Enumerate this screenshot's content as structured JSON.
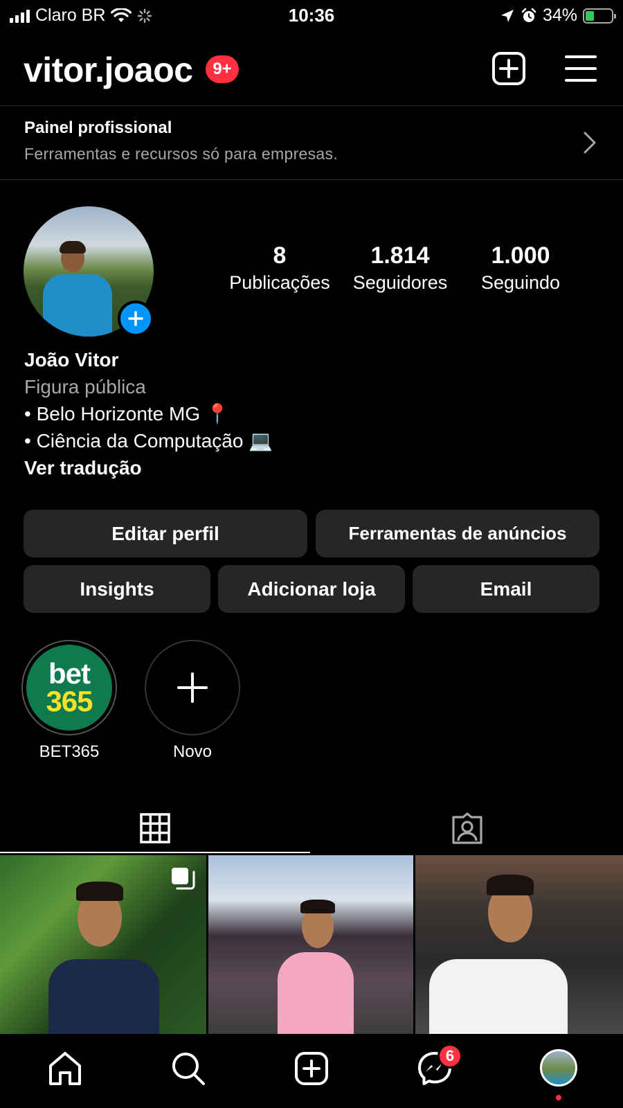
{
  "status_bar": {
    "carrier": "Claro BR",
    "time": "10:36",
    "battery_percent": "34%",
    "battery_level": 0.34,
    "icons": [
      "signal-icon",
      "wifi-icon",
      "activity-icon",
      "location-icon",
      "alarm-icon",
      "battery-icon"
    ]
  },
  "header": {
    "username": "vitor.joaoc",
    "notification_badge": "9+",
    "icons": [
      "new-post-icon",
      "menu-icon"
    ]
  },
  "pro_panel": {
    "title": "Painel profissional",
    "subtitle": "Ferramentas e recursos só para empresas."
  },
  "profile": {
    "stats": [
      {
        "value": "8",
        "label": "Publicações"
      },
      {
        "value": "1.814",
        "label": "Seguidores"
      },
      {
        "value": "1.000",
        "label": "Seguindo"
      }
    ],
    "name": "João Vitor",
    "category": "Figura pública",
    "bio_lines": [
      "• Belo Horizonte MG 📍",
      "• Ciência da Computação 💻"
    ],
    "translate_link": "Ver tradução"
  },
  "buttons": {
    "edit_profile": "Editar perfil",
    "ad_tools": "Ferramentas de anúncios",
    "insights": "Insights",
    "add_shop": "Adicionar loja",
    "email": "Email"
  },
  "highlights": [
    {
      "label": "BET365",
      "logo_top": "bet",
      "logo_bottom": "365"
    },
    {
      "label": "Novo"
    }
  ],
  "tabs": [
    "grid-icon",
    "tagged-icon"
  ],
  "bottom_nav": {
    "message_badge": "6",
    "icons": [
      "home-icon",
      "search-icon",
      "create-icon",
      "messenger-icon",
      "profile-avatar"
    ]
  },
  "colors": {
    "background": "#000000",
    "button_bg": "#262626",
    "accent_blue": "#0095f6",
    "badge_red": "#ff3040",
    "secondary_text": "#a8a8a8"
  }
}
